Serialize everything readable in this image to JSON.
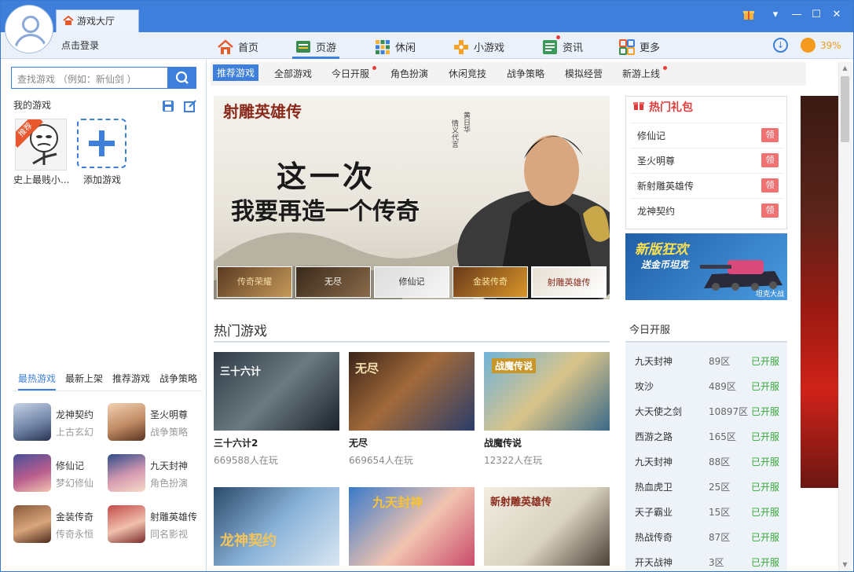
{
  "header": {
    "hall_tab": "游戏大厅",
    "login": "点击登录",
    "nav": [
      {
        "label": "首页",
        "icon": "home-icon"
      },
      {
        "label": "页游",
        "icon": "webgame-icon"
      },
      {
        "label": "休闲",
        "icon": "casual-icon"
      },
      {
        "label": "小游戏",
        "icon": "minigame-icon"
      },
      {
        "label": "资讯",
        "icon": "news-icon"
      },
      {
        "label": "更多",
        "icon": "more-icon"
      }
    ],
    "active_nav": "页游",
    "speed_percent": "39%"
  },
  "sidebar": {
    "search_placeholder": "查找游戏 （例如：新仙剑 ）",
    "my_games_label": "我的游戏",
    "my_game_tile": {
      "name": "史上最贱小...",
      "badge": "推荐"
    },
    "add_game_label": "添加游戏",
    "tabs": [
      "最热游戏",
      "最新上架",
      "推荐游戏",
      "战争策略"
    ],
    "active_tab": "最热游戏",
    "games": [
      {
        "name": "龙神契约",
        "tag": "上古玄幻"
      },
      {
        "name": "圣火明尊",
        "tag": "战争策略"
      },
      {
        "name": "修仙记",
        "tag": "梦幻修仙"
      },
      {
        "name": "九天封神",
        "tag": "角色扮演"
      },
      {
        "name": "金装传奇",
        "tag": "传奇永恒"
      },
      {
        "name": "射雕英雄传",
        "tag": "同名影视"
      }
    ]
  },
  "subnav": {
    "items": [
      "推荐游戏",
      "全部游戏",
      "今日开服",
      "角色扮演",
      "休闲竞技",
      "战争策略",
      "模拟经营",
      "新游上线"
    ],
    "active": "推荐游戏"
  },
  "banner": {
    "logo": "射雕英雄传",
    "slogan_line1": "这一次",
    "slogan_line2": "我要再造一个传奇",
    "actor_caption": "黄日华",
    "actor_caption2": "情义代言",
    "thumbnails": [
      "传奇荣耀",
      "无尽",
      "修仙记",
      "金装传奇",
      "射雕英雄传"
    ]
  },
  "hot_games": {
    "title": "热门游戏",
    "cards": [
      {
        "name": "三十六计2",
        "players": "669588人在玩",
        "art": "三十六计"
      },
      {
        "name": "无尽",
        "players": "669654人在玩",
        "art": "无尽"
      },
      {
        "name": "战魔传说",
        "players": "12322人在玩",
        "art": "战魔传说"
      },
      {
        "name": "",
        "players": "",
        "art": "龙神契约"
      },
      {
        "name": "",
        "players": "",
        "art": "九天封神"
      },
      {
        "name": "",
        "players": "",
        "art": "新射雕英雄传"
      }
    ]
  },
  "gift": {
    "title": "热门礼包",
    "button_label": "领",
    "items": [
      "修仙记",
      "圣火明尊",
      "新射雕英雄传",
      "龙神契约"
    ]
  },
  "ad": {
    "title": "新版狂欢",
    "subtitle": "送金币坦克",
    "corner": "坦克大战"
  },
  "today_open": {
    "title": "今日开服",
    "rows": [
      {
        "name": "九天封神",
        "zone": "89区",
        "status": "已开服"
      },
      {
        "name": "攻沙",
        "zone": "489区",
        "status": "已开服"
      },
      {
        "name": "大天使之剑",
        "zone": "10897区",
        "status": "已开服"
      },
      {
        "name": "西游之路",
        "zone": "165区",
        "status": "已开服"
      },
      {
        "name": "九天封神",
        "zone": "88区",
        "status": "已开服"
      },
      {
        "name": "热血虎卫",
        "zone": "25区",
        "status": "已开服"
      },
      {
        "name": "天子霸业",
        "zone": "15区",
        "status": "已开服"
      },
      {
        "name": "热战传奇",
        "zone": "87区",
        "status": "已开服"
      },
      {
        "name": "开天战神",
        "zone": "3区",
        "status": "已开服"
      }
    ]
  },
  "colors": {
    "accent": "#3d7fdb",
    "open_status": "#35a936",
    "gift_title": "#e03b3b",
    "gift_button": "#f07272"
  }
}
